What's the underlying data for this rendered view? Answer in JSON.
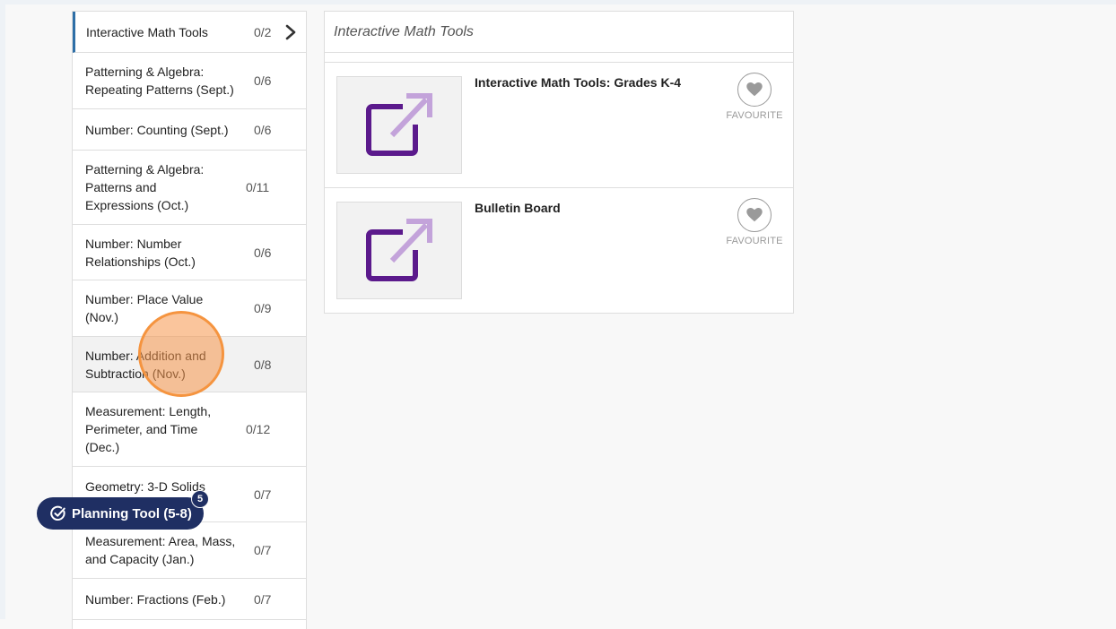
{
  "sidebar": {
    "items": [
      {
        "label": "Interactive Math Tools",
        "count": "0/2"
      },
      {
        "label": "Patterning & Algebra: Repeating Patterns (Sept.)",
        "count": "0/6"
      },
      {
        "label": "Number: Counting (Sept.)",
        "count": "0/6"
      },
      {
        "label": "Patterning & Algebra: Patterns and Expressions (Oct.)",
        "count": "0/11"
      },
      {
        "label": "Number: Number Relationships (Oct.)",
        "count": "0/6"
      },
      {
        "label": "Number: Place Value (Nov.)",
        "count": "0/9"
      },
      {
        "label": "Number: Addition and Subtraction (Nov.)",
        "count": "0/8"
      },
      {
        "label": "Measurement: Length, Perimeter, and Time (Dec.)",
        "count": "0/12"
      },
      {
        "label": "Geometry: 3-D Solids",
        "count": "0/7"
      },
      {
        "label": "Measurement: Area, Mass, and Capacity (Jan.)",
        "count": "0/7"
      },
      {
        "label": "Number: Fractions (Feb.)",
        "count": "0/7"
      }
    ]
  },
  "main": {
    "title": "Interactive Math Tools",
    "resources": [
      {
        "title": "Interactive Math Tools: Grades K-4",
        "favourite_label": "FAVOURITE"
      },
      {
        "title": "Bulletin Board",
        "favourite_label": "FAVOURITE"
      }
    ]
  },
  "planning_tool": {
    "label": "Planning Tool (5-8)",
    "badge": "5"
  },
  "colors": {
    "accent": "#2e6fa7",
    "launch_icon": "#5b1a8c",
    "launch_arrow": "#c3a3da",
    "planning_bg": "#1f2f63",
    "click_marker": "#f5943f"
  },
  "icons": {
    "chevron": "chevron-right-icon",
    "launch": "external-link-icon",
    "favourite": "heart-icon",
    "planning": "check-circle-icon"
  }
}
